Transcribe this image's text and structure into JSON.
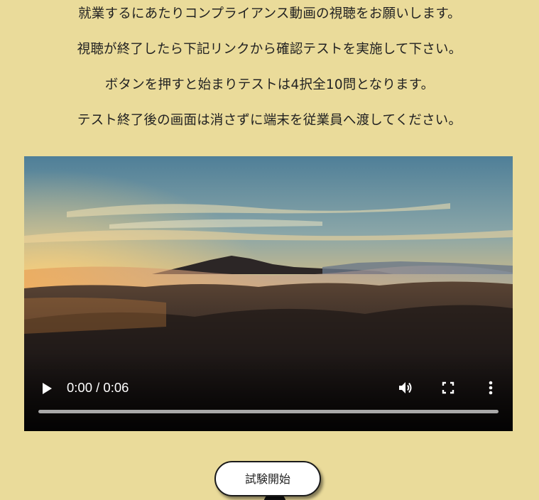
{
  "instructions": [
    "就業するにあたりコンプライアンス動画の視聴をお願いします。",
    "視聴が終了したら下記リンクから確認テストを実施して下さい。",
    "ボタンを押すと始まりテストは4択全10問となります。",
    "テスト終了後の画面は消さずに端末を従業員へ渡してください。"
  ],
  "video": {
    "time_display": "0:00 / 0:06",
    "progress_fraction": 0,
    "play_icon": "play-icon",
    "volume_icon": "volume-icon",
    "fullscreen_icon": "fullscreen-icon",
    "more_icon": "more-vert-icon"
  },
  "start_button": {
    "label": "試験開始"
  },
  "colors": {
    "page_background": "#eadb9a",
    "button_background": "#ffffff"
  }
}
